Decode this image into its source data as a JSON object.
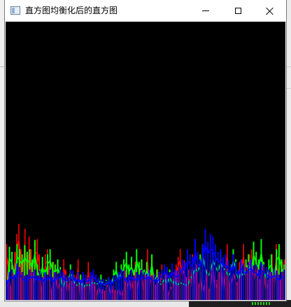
{
  "window": {
    "title": "直方图均衡化后的直方图",
    "icon": "app-window-icon",
    "controls": [
      "minimize-icon",
      "maximize-icon",
      "close-icon"
    ]
  },
  "colors": {
    "background": "#000000",
    "red_channel": "#ff0000",
    "green_channel": "#00ff00",
    "blue_channel": "#0000ff"
  },
  "chart_data": {
    "type": "bar",
    "title": "",
    "xlabel": "",
    "ylabel": "",
    "xlim": [
      0,
      255
    ],
    "ylim": [
      0,
      400
    ],
    "grid": false,
    "legend": "none",
    "series": [
      {
        "color": "#ff0000",
        "values": [
          110,
          80,
          20,
          60,
          95,
          130,
          150,
          100,
          70,
          140,
          60,
          125,
          100,
          40,
          118,
          120,
          90,
          20,
          45,
          90,
          100,
          60,
          10,
          75,
          60,
          25,
          42,
          20,
          80,
          60,
          15,
          50,
          38,
          50,
          45,
          80,
          10,
          40,
          30,
          28,
          75,
          15,
          48,
          35,
          10,
          36,
          15,
          22,
          18,
          32,
          40,
          12,
          28,
          20,
          15,
          30,
          8,
          18,
          58,
          30,
          60,
          22,
          45,
          75,
          28,
          68,
          80,
          25,
          50,
          100,
          30,
          85,
          45,
          30,
          60,
          40,
          70,
          20,
          50,
          10,
          35,
          25,
          55,
          70,
          85,
          100,
          60,
          78,
          45,
          60,
          30,
          90,
          40,
          70,
          30,
          55,
          15,
          40,
          60,
          20,
          35,
          95,
          25,
          40,
          55,
          80,
          20,
          70,
          110,
          35,
          40,
          70,
          50,
          35,
          75,
          80,
          110,
          60,
          70,
          90,
          100,
          48,
          80,
          65,
          40,
          85,
          70,
          25,
          40,
          55,
          90,
          30,
          110,
          60,
          40,
          75,
          80
        ]
      },
      {
        "color": "#00ff00",
        "values": [
          30,
          105,
          95,
          60,
          110,
          100,
          90,
          108,
          95,
          100,
          80,
          118,
          70,
          60,
          85,
          60,
          90,
          100,
          75,
          70,
          80,
          65,
          30,
          50,
          45,
          70,
          50,
          40,
          35,
          50,
          30,
          40,
          35,
          40,
          45,
          40,
          42,
          50,
          38,
          40,
          45,
          40,
          60,
          75,
          50,
          70,
          80,
          95,
          70,
          85,
          60,
          100,
          75,
          80,
          60,
          75,
          55,
          90,
          50,
          60,
          40,
          40,
          55,
          40,
          60,
          40,
          50,
          35,
          45,
          40,
          40,
          35,
          55,
          60,
          80,
          70,
          90,
          110,
          80,
          60,
          70,
          100,
          85,
          70,
          95,
          80,
          75,
          60,
          70,
          100,
          80,
          50,
          70,
          60,
          80,
          90,
          70,
          115,
          95,
          80,
          120,
          75,
          50,
          80,
          90,
          50,
          100,
          110,
          80,
          70
        ]
      },
      {
        "color": "#0000ff",
        "values": [
          40,
          55,
          60,
          50,
          72,
          65,
          55,
          48,
          50,
          60,
          55,
          60,
          48,
          58,
          45,
          55,
          50,
          60,
          45,
          55,
          52,
          60,
          55,
          50,
          48,
          60,
          58,
          45,
          55,
          40,
          55,
          50,
          45,
          55,
          60,
          50,
          45,
          40,
          42,
          38,
          45,
          40,
          48,
          50,
          55,
          60,
          58,
          45,
          50,
          60,
          48,
          55,
          50,
          60,
          55,
          52,
          60,
          48,
          50,
          45,
          55,
          60,
          70,
          65,
          55,
          72,
          60,
          58,
          65,
          80,
          75,
          100,
          90,
          85,
          120,
          95,
          80,
          110,
          140,
          115,
          130,
          125,
          110,
          95,
          100,
          85,
          90,
          78,
          70,
          90,
          75,
          60,
          80,
          72,
          65,
          75,
          80,
          68,
          70,
          60,
          75,
          70,
          65,
          60,
          55,
          62,
          58,
          50,
          55,
          60
        ]
      }
    ]
  }
}
